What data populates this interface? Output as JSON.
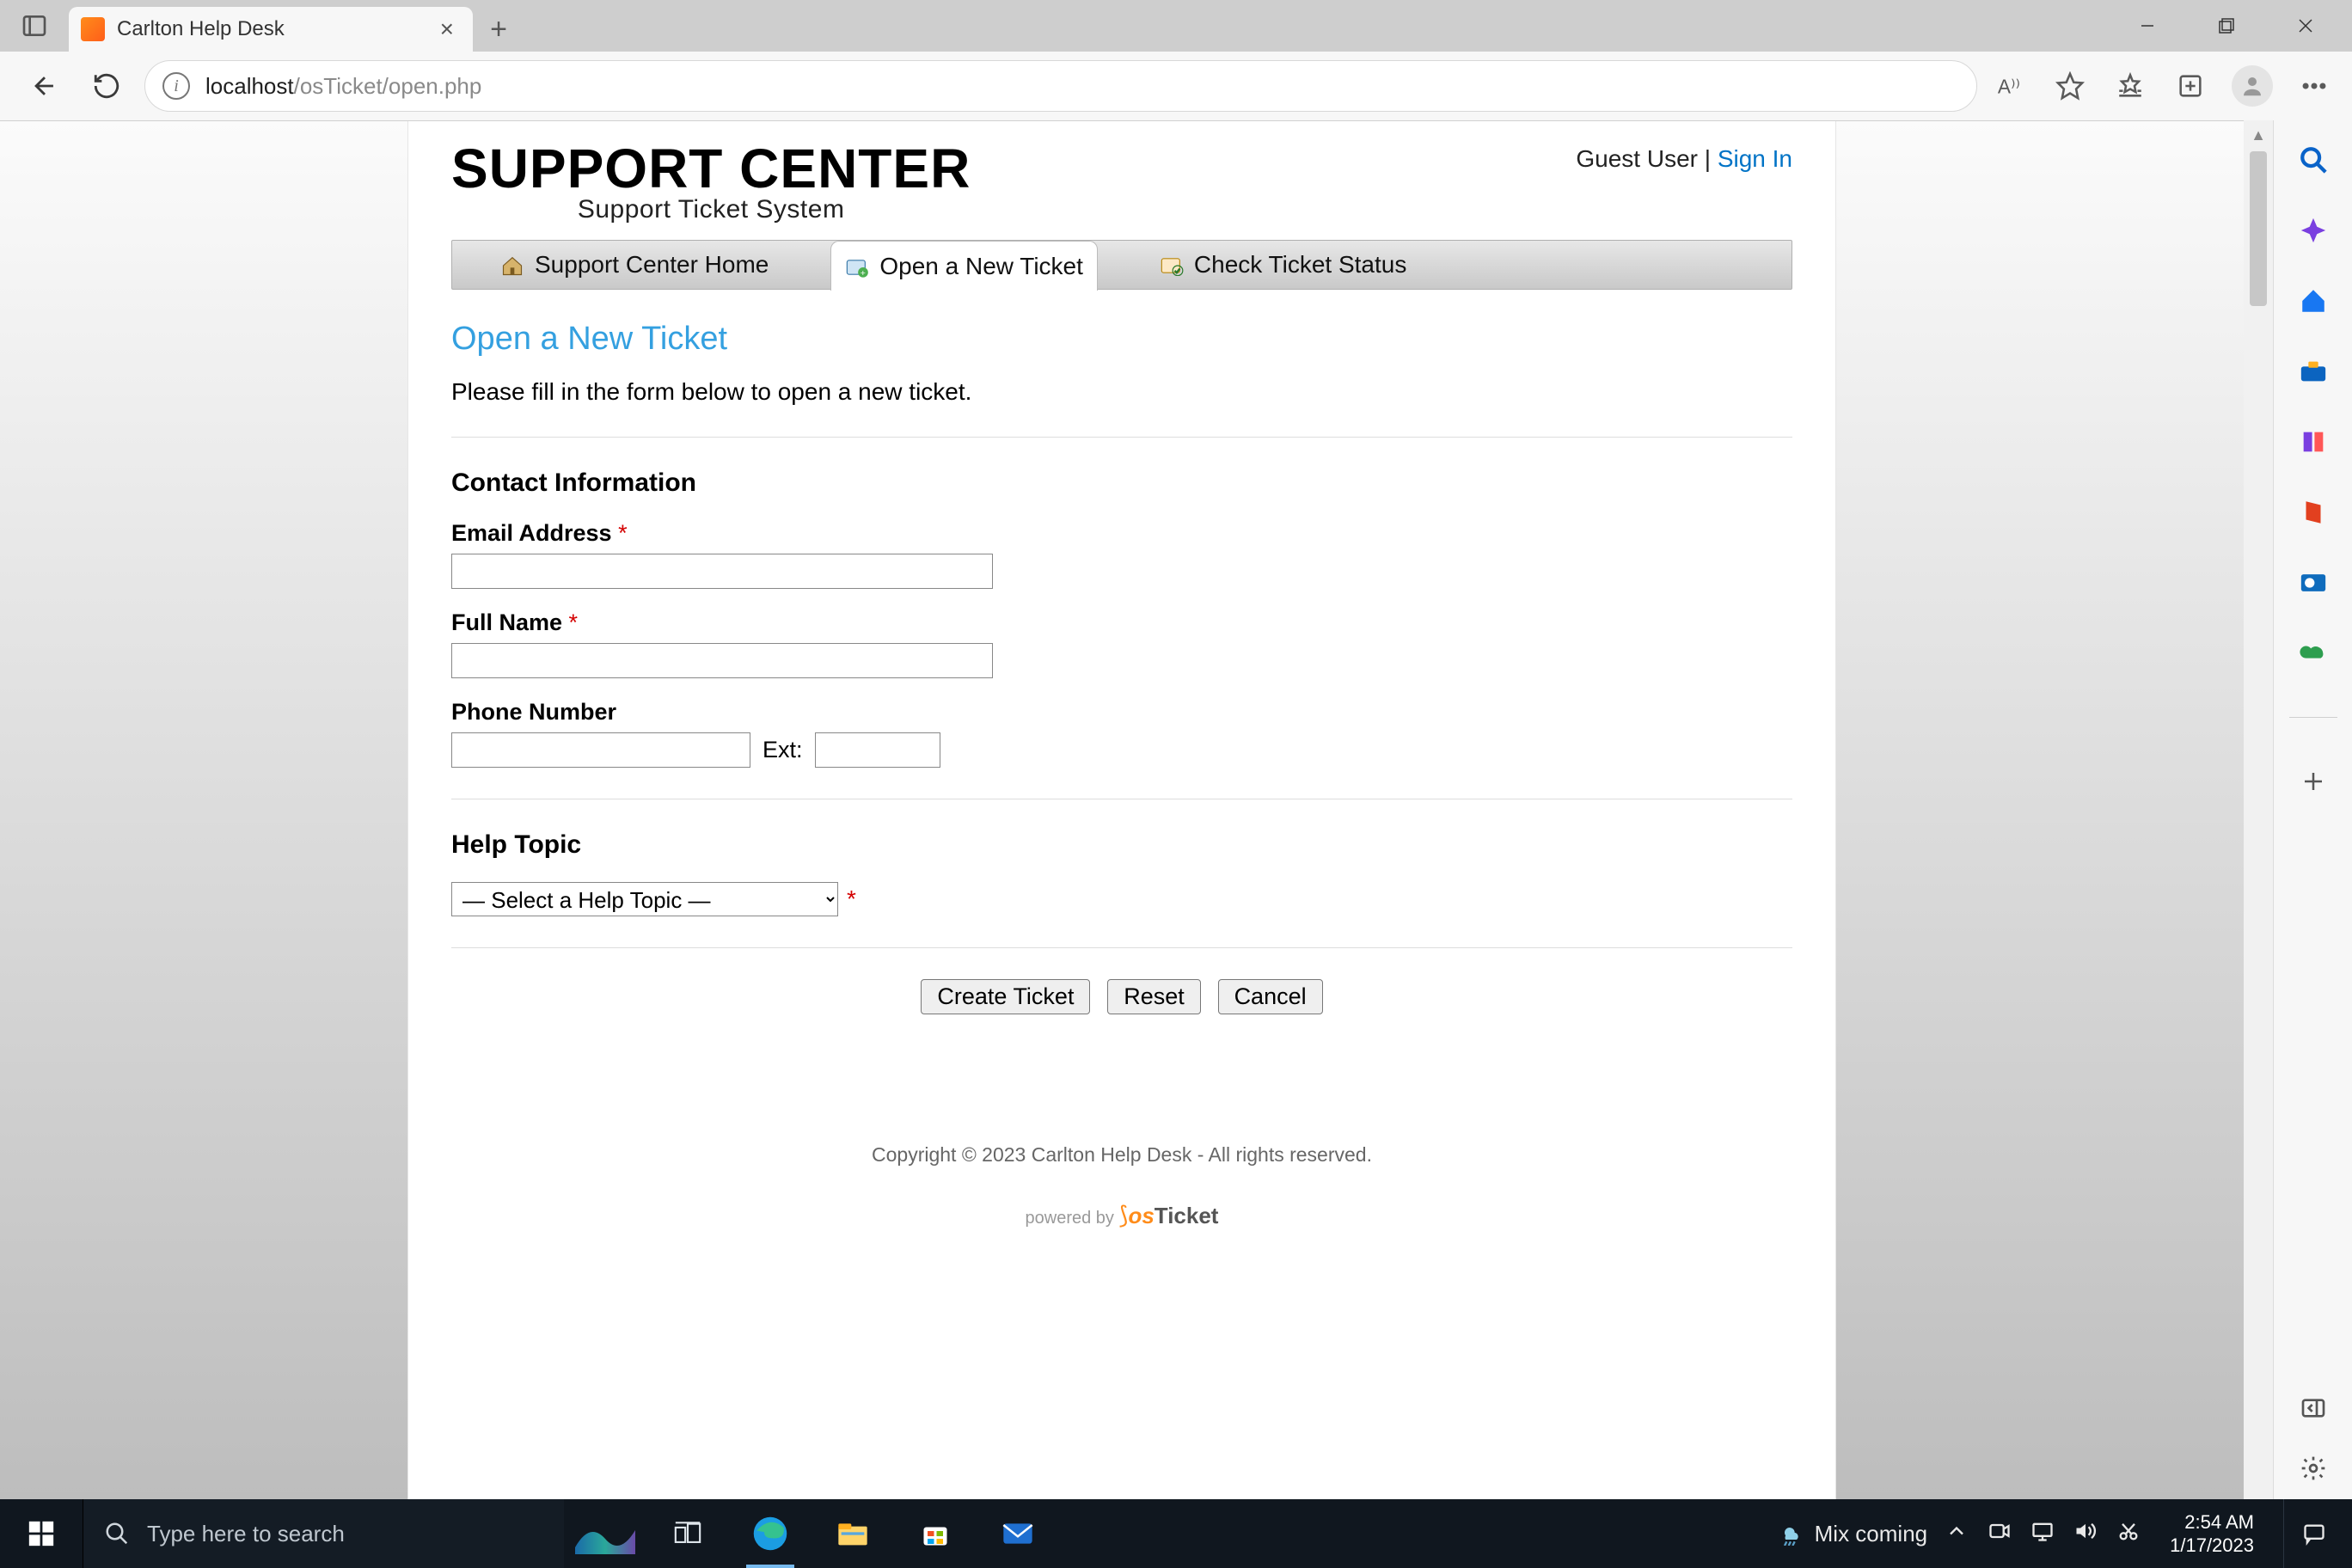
{
  "browser": {
    "tab_title": "Carlton Help Desk",
    "url_host": "localhost",
    "url_path": "/osTicket/open.php"
  },
  "header": {
    "title": "SUPPORT CENTER",
    "subtitle": "Support Ticket System",
    "guest_label": "Guest User",
    "separator": " | ",
    "signin_label": "Sign In"
  },
  "nav": {
    "home": "Support Center Home",
    "open": "Open a New Ticket",
    "status": "Check Ticket Status"
  },
  "page": {
    "title": "Open a New Ticket",
    "desc": "Please fill in the form below to open a new ticket.",
    "contact_h": "Contact Information",
    "email_label": "Email Address",
    "fullname_label": "Full Name",
    "phone_label": "Phone Number",
    "ext_label": "Ext:",
    "helptopic_h": "Help Topic",
    "helptopic_placeholder": "— Select a Help Topic —",
    "required": " *"
  },
  "buttons": {
    "create": "Create Ticket",
    "reset": "Reset",
    "cancel": "Cancel"
  },
  "footer": {
    "copyright": "Copyright © 2023 Carlton Help Desk - All rights reserved.",
    "powered_prefix": "powered by ",
    "powered_os": "os",
    "powered_ticket": "Ticket"
  },
  "taskbar": {
    "search_placeholder": "Type here to search",
    "weather": "Mix coming",
    "time": "2:54 AM",
    "date": "1/17/2023"
  }
}
